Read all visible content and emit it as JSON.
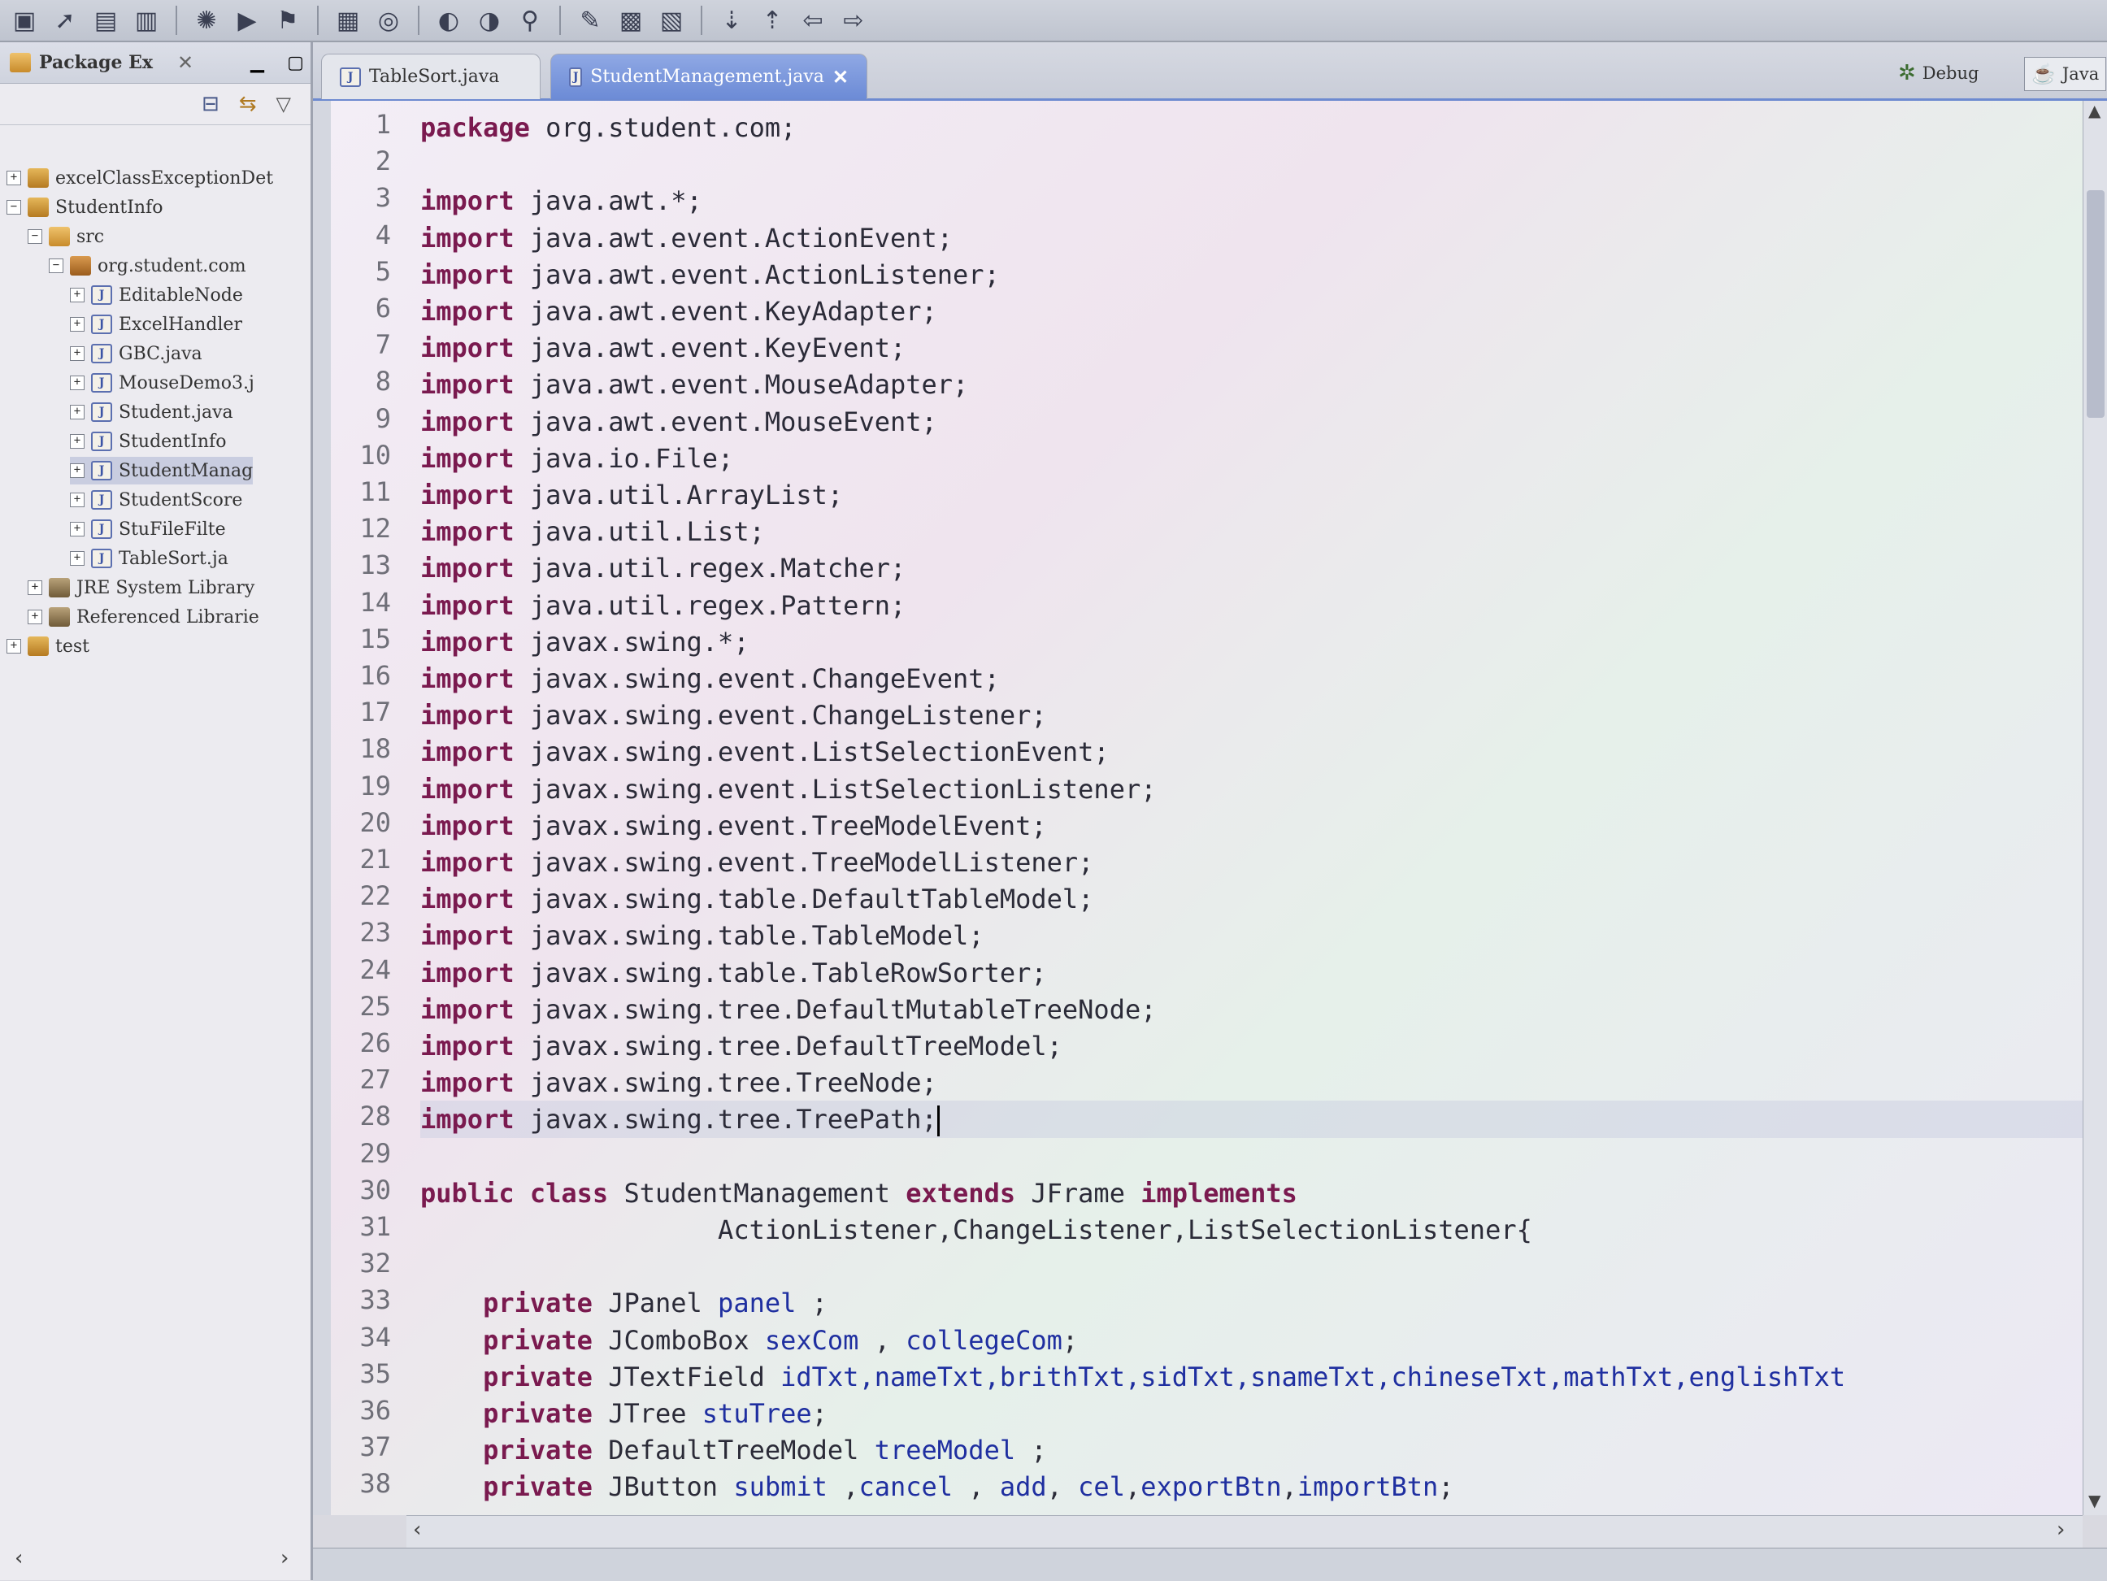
{
  "explorer": {
    "title": "Package Ex",
    "tree": [
      {
        "label": "excelClassExceptionDet",
        "type": "project",
        "level": 0,
        "expander": "+"
      },
      {
        "label": "StudentInfo",
        "type": "project",
        "level": 0,
        "expander": "−"
      },
      {
        "label": "src",
        "type": "folder",
        "level": 1,
        "expander": "−"
      },
      {
        "label": "org.student.com",
        "type": "package",
        "level": 2,
        "expander": "−"
      },
      {
        "label": "EditableNode",
        "type": "java",
        "level": 3,
        "expander": "+"
      },
      {
        "label": "ExcelHandler",
        "type": "java",
        "level": 3,
        "expander": "+"
      },
      {
        "label": "GBC.java",
        "type": "java",
        "level": 3,
        "expander": "+"
      },
      {
        "label": "MouseDemo3.j",
        "type": "java",
        "level": 3,
        "expander": "+"
      },
      {
        "label": "Student.java",
        "type": "java",
        "level": 3,
        "expander": "+"
      },
      {
        "label": "StudentInfo",
        "type": "java",
        "level": 3,
        "expander": "+"
      },
      {
        "label": "StudentManag",
        "type": "java",
        "level": 3,
        "expander": "+",
        "selected": true
      },
      {
        "label": "StudentScore",
        "type": "java",
        "level": 3,
        "expander": "+"
      },
      {
        "label": "StuFileFilte",
        "type": "java",
        "level": 3,
        "expander": "+"
      },
      {
        "label": "TableSort.ja",
        "type": "java",
        "level": 3,
        "expander": "+"
      },
      {
        "label": "JRE System Library",
        "type": "lib",
        "level": 1,
        "expander": "+"
      },
      {
        "label": "Referenced Librarie",
        "type": "lib",
        "level": 1,
        "expander": "+"
      },
      {
        "label": "test",
        "type": "project",
        "level": 0,
        "expander": "+"
      }
    ]
  },
  "tabs": [
    {
      "label": "TableSort.java",
      "active": false
    },
    {
      "label": "StudentManagement.java",
      "active": true
    }
  ],
  "perspectives": {
    "debug": "Debug",
    "java": "Java"
  },
  "editor": {
    "current_line": 28,
    "lines": [
      {
        "n": "1",
        "segs": [
          {
            "t": "package",
            "k": "kw"
          },
          {
            "t": " org.student.com;",
            "k": "plain"
          }
        ]
      },
      {
        "n": "2",
        "segs": []
      },
      {
        "n": "3",
        "segs": [
          {
            "t": "import",
            "k": "kw"
          },
          {
            "t": " java.awt.*;",
            "k": "plain"
          }
        ]
      },
      {
        "n": "4",
        "segs": [
          {
            "t": "import",
            "k": "kw"
          },
          {
            "t": " java.awt.event.ActionEvent;",
            "k": "plain"
          }
        ]
      },
      {
        "n": "5",
        "segs": [
          {
            "t": "import",
            "k": "kw"
          },
          {
            "t": " java.awt.event.ActionListener;",
            "k": "plain"
          }
        ]
      },
      {
        "n": "6",
        "segs": [
          {
            "t": "import",
            "k": "kw"
          },
          {
            "t": " java.awt.event.KeyAdapter;",
            "k": "plain"
          }
        ]
      },
      {
        "n": "7",
        "segs": [
          {
            "t": "import",
            "k": "kw"
          },
          {
            "t": " java.awt.event.KeyEvent;",
            "k": "plain"
          }
        ]
      },
      {
        "n": "8",
        "segs": [
          {
            "t": "import",
            "k": "kw"
          },
          {
            "t": " java.awt.event.MouseAdapter;",
            "k": "plain"
          }
        ]
      },
      {
        "n": "9",
        "segs": [
          {
            "t": "import",
            "k": "kw"
          },
          {
            "t": " java.awt.event.MouseEvent;",
            "k": "plain"
          }
        ]
      },
      {
        "n": "10",
        "segs": [
          {
            "t": "import",
            "k": "kw"
          },
          {
            "t": " java.io.File;",
            "k": "plain"
          }
        ]
      },
      {
        "n": "11",
        "segs": [
          {
            "t": "import",
            "k": "kw"
          },
          {
            "t": " java.util.ArrayList;",
            "k": "plain"
          }
        ]
      },
      {
        "n": "12",
        "segs": [
          {
            "t": "import",
            "k": "kw"
          },
          {
            "t": " java.util.List;",
            "k": "plain"
          }
        ]
      },
      {
        "n": "13",
        "segs": [
          {
            "t": "import",
            "k": "kw"
          },
          {
            "t": " java.util.regex.Matcher;",
            "k": "plain"
          }
        ]
      },
      {
        "n": "14",
        "segs": [
          {
            "t": "import",
            "k": "kw"
          },
          {
            "t": " java.util.regex.Pattern;",
            "k": "plain"
          }
        ]
      },
      {
        "n": "15",
        "segs": [
          {
            "t": "import",
            "k": "kw"
          },
          {
            "t": " javax.swing.*;",
            "k": "plain"
          }
        ]
      },
      {
        "n": "16",
        "segs": [
          {
            "t": "import",
            "k": "kw"
          },
          {
            "t": " javax.swing.event.ChangeEvent;",
            "k": "plain"
          }
        ]
      },
      {
        "n": "17",
        "segs": [
          {
            "t": "import",
            "k": "kw"
          },
          {
            "t": " javax.swing.event.ChangeListener;",
            "k": "plain"
          }
        ]
      },
      {
        "n": "18",
        "segs": [
          {
            "t": "import",
            "k": "kw"
          },
          {
            "t": " javax.swing.event.ListSelectionEvent;",
            "k": "plain"
          }
        ]
      },
      {
        "n": "19",
        "segs": [
          {
            "t": "import",
            "k": "kw"
          },
          {
            "t": " javax.swing.event.ListSelectionListener;",
            "k": "plain"
          }
        ]
      },
      {
        "n": "20",
        "segs": [
          {
            "t": "import",
            "k": "kw"
          },
          {
            "t": " javax.swing.event.TreeModelEvent;",
            "k": "plain"
          }
        ]
      },
      {
        "n": "21",
        "segs": [
          {
            "t": "import",
            "k": "kw"
          },
          {
            "t": " javax.swing.event.TreeModelListener;",
            "k": "plain"
          }
        ]
      },
      {
        "n": "22",
        "segs": [
          {
            "t": "import",
            "k": "kw"
          },
          {
            "t": " javax.swing.table.DefaultTableModel;",
            "k": "plain"
          }
        ]
      },
      {
        "n": "23",
        "segs": [
          {
            "t": "import",
            "k": "kw"
          },
          {
            "t": " javax.swing.table.TableModel;",
            "k": "plain"
          }
        ]
      },
      {
        "n": "24",
        "segs": [
          {
            "t": "import",
            "k": "kw"
          },
          {
            "t": " javax.swing.table.TableRowSorter;",
            "k": "plain"
          }
        ]
      },
      {
        "n": "25",
        "segs": [
          {
            "t": "import",
            "k": "kw"
          },
          {
            "t": " javax.swing.tree.DefaultMutableTreeNode;",
            "k": "plain"
          }
        ]
      },
      {
        "n": "26",
        "segs": [
          {
            "t": "import",
            "k": "kw"
          },
          {
            "t": " javax.swing.tree.DefaultTreeModel;",
            "k": "plain"
          }
        ]
      },
      {
        "n": "27",
        "segs": [
          {
            "t": "import",
            "k": "kw"
          },
          {
            "t": " javax.swing.tree.TreeNode;",
            "k": "plain"
          }
        ]
      },
      {
        "n": "28",
        "segs": [
          {
            "t": "import",
            "k": "kw"
          },
          {
            "t": " javax.swing.tree.TreePath;",
            "k": "plain"
          }
        ],
        "caret": true
      },
      {
        "n": "29",
        "segs": []
      },
      {
        "n": "30",
        "segs": [
          {
            "t": "public",
            "k": "kw"
          },
          {
            "t": " ",
            "k": "plain"
          },
          {
            "t": "class",
            "k": "kw"
          },
          {
            "t": " StudentManagement ",
            "k": "plain"
          },
          {
            "t": "extends",
            "k": "kw"
          },
          {
            "t": " JFrame ",
            "k": "plain"
          },
          {
            "t": "implements",
            "k": "kw"
          }
        ]
      },
      {
        "n": "31",
        "segs": [
          {
            "t": "                   ActionListener,ChangeListener,ListSelectionListener{",
            "k": "plain"
          }
        ]
      },
      {
        "n": "32",
        "segs": []
      },
      {
        "n": "33",
        "segs": [
          {
            "t": "    ",
            "k": "plain"
          },
          {
            "t": "private",
            "k": "kw"
          },
          {
            "t": " JPanel ",
            "k": "plain"
          },
          {
            "t": "panel",
            "k": "ident"
          },
          {
            "t": " ;",
            "k": "plain"
          }
        ]
      },
      {
        "n": "34",
        "segs": [
          {
            "t": "    ",
            "k": "plain"
          },
          {
            "t": "private",
            "k": "kw"
          },
          {
            "t": " JComboBox ",
            "k": "plain"
          },
          {
            "t": "sexCom",
            "k": "ident"
          },
          {
            "t": " , ",
            "k": "plain"
          },
          {
            "t": "collegeCom",
            "k": "ident"
          },
          {
            "t": ";",
            "k": "plain"
          }
        ]
      },
      {
        "n": "35",
        "segs": [
          {
            "t": "    ",
            "k": "plain"
          },
          {
            "t": "private",
            "k": "kw"
          },
          {
            "t": " JTextField ",
            "k": "plain"
          },
          {
            "t": "idTxt,nameTxt,brithTxt,sidTxt,snameTxt,chineseTxt,mathTxt,englishTxt",
            "k": "ident"
          }
        ]
      },
      {
        "n": "36",
        "segs": [
          {
            "t": "    ",
            "k": "plain"
          },
          {
            "t": "private",
            "k": "kw"
          },
          {
            "t": " JTree ",
            "k": "plain"
          },
          {
            "t": "stuTree",
            "k": "ident"
          },
          {
            "t": ";",
            "k": "plain"
          }
        ]
      },
      {
        "n": "37",
        "segs": [
          {
            "t": "    ",
            "k": "plain"
          },
          {
            "t": "private",
            "k": "kw"
          },
          {
            "t": " DefaultTreeModel ",
            "k": "plain"
          },
          {
            "t": "treeModel",
            "k": "ident"
          },
          {
            "t": " ;",
            "k": "plain"
          }
        ]
      },
      {
        "n": "38",
        "segs": [
          {
            "t": "    ",
            "k": "plain"
          },
          {
            "t": "private",
            "k": "kw"
          },
          {
            "t": " JButton ",
            "k": "plain"
          },
          {
            "t": "submit",
            "k": "ident"
          },
          {
            "t": " ,",
            "k": "plain"
          },
          {
            "t": "cancel",
            "k": "ident"
          },
          {
            "t": " , ",
            "k": "plain"
          },
          {
            "t": "add",
            "k": "ident"
          },
          {
            "t": ", ",
            "k": "plain"
          },
          {
            "t": "cel",
            "k": "ident"
          },
          {
            "t": ",",
            "k": "plain"
          },
          {
            "t": "exportBtn",
            "k": "ident"
          },
          {
            "t": ",",
            "k": "plain"
          },
          {
            "t": "importBtn",
            "k": "ident"
          },
          {
            "t": ";",
            "k": "plain"
          }
        ]
      }
    ]
  },
  "toolbar_icons": [
    "new-icon",
    "pointer-icon",
    "save-icon",
    "print-icon",
    "debug-icon",
    "run-icon",
    "external-tools-icon",
    "new-java-project-icon",
    "new-package-icon",
    "new-class-icon",
    "open-type-icon",
    "search-icon",
    "toggle-mark-icon",
    "back-icon",
    "forward-icon"
  ],
  "explorer_tool_icons": [
    "collapse-all-icon",
    "link-with-editor-icon",
    "view-menu-icon"
  ]
}
